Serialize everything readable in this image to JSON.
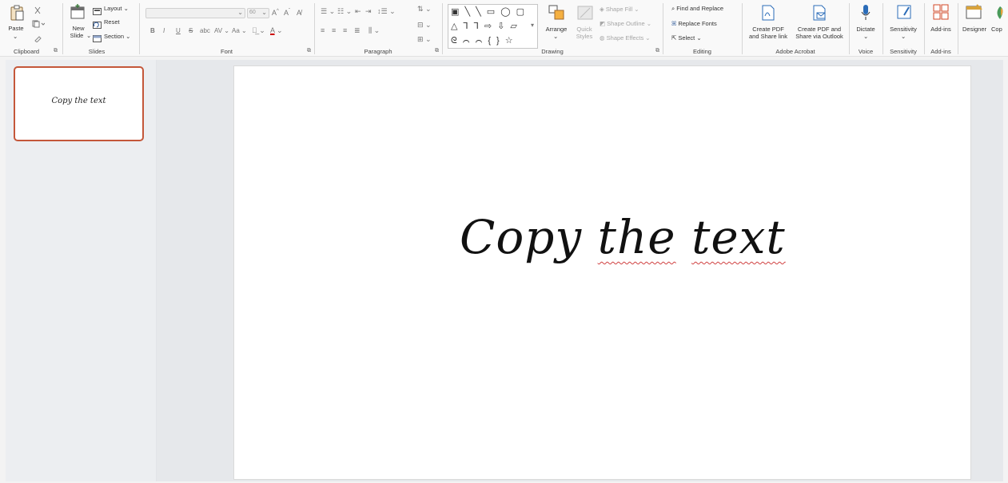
{
  "ribbon": {
    "clipboard": {
      "label": "Clipboard",
      "paste": "Paste"
    },
    "slides": {
      "label": "Slides",
      "new_slide_1": "New",
      "new_slide_2": "Slide",
      "layout": "Layout",
      "reset": "Reset",
      "section": "Section"
    },
    "font": {
      "label": "Font",
      "font_size": "60"
    },
    "paragraph": {
      "label": "Paragraph"
    },
    "drawing": {
      "label": "Drawing",
      "arrange": "Arrange",
      "quick_styles_1": "Quick",
      "quick_styles_2": "Styles",
      "shape_fill": "Shape Fill",
      "shape_outline": "Shape Outline",
      "shape_effects": "Shape Effects"
    },
    "editing": {
      "label": "Editing",
      "find_replace": "Find and Replace",
      "replace_fonts": "Replace Fonts",
      "select": "Select"
    },
    "acrobat": {
      "label": "Adobe Acrobat",
      "create_pdf_1": "Create PDF",
      "create_pdf_2": "and Share link",
      "create_pdf_outlook_1": "Create PDF and",
      "create_pdf_outlook_2": "Share via Outlook"
    },
    "voice": {
      "label": "Voice",
      "dictate": "Dictate"
    },
    "sensitivity": {
      "label": "Sensitivity",
      "button": "Sensitivity"
    },
    "addins": {
      "label": "Add-ins",
      "button": "Add-ins"
    },
    "designer": {
      "button": "Designer"
    },
    "copilot": {
      "button": "Cop"
    }
  },
  "slides_pane": {
    "thumbnail_text": "Copy the text"
  },
  "slide": {
    "text_part1": "Copy ",
    "text_part2": "the",
    "text_part3": " ",
    "text_part4": "text"
  },
  "colors": {
    "accent": "#c4573a",
    "ribbon_bg": "#f9f9f9",
    "canvas_bg": "#e6e8eb"
  }
}
